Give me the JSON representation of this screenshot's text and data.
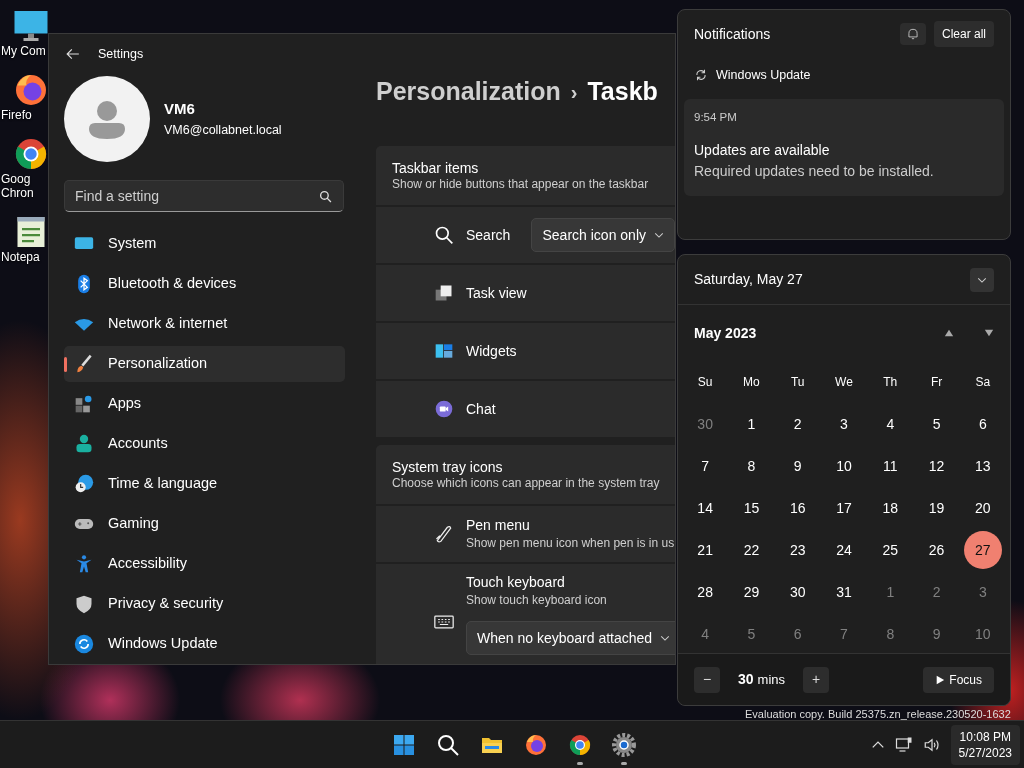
{
  "desktop_icons": [
    {
      "kind": "computer",
      "lines": [
        "My Com"
      ]
    },
    {
      "kind": "firefox",
      "lines": [
        "Firefo"
      ]
    },
    {
      "kind": "chrome",
      "lines": [
        "Goog",
        "Chron"
      ]
    },
    {
      "kind": "notepad",
      "lines": [
        "Notepa"
      ]
    }
  ],
  "settings": {
    "title": "Settings",
    "user": {
      "name": "VM6",
      "email": "VM6@collabnet.local"
    },
    "search": {
      "placeholder": "Find a setting"
    },
    "nav": [
      {
        "kind": "system",
        "label": "System",
        "selected": false
      },
      {
        "kind": "bluetooth",
        "label": "Bluetooth & devices",
        "selected": false
      },
      {
        "kind": "network",
        "label": "Network & internet",
        "selected": false
      },
      {
        "kind": "brush",
        "label": "Personalization",
        "selected": true
      },
      {
        "kind": "apps",
        "label": "Apps",
        "selected": false
      },
      {
        "kind": "accounts",
        "label": "Accounts",
        "selected": false
      },
      {
        "kind": "time",
        "label": "Time & language",
        "selected": false
      },
      {
        "kind": "gaming",
        "label": "Gaming",
        "selected": false
      },
      {
        "kind": "accessibility",
        "label": "Accessibility",
        "selected": false
      },
      {
        "kind": "privacy",
        "label": "Privacy & security",
        "selected": false
      },
      {
        "kind": "update",
        "label": "Windows Update",
        "selected": false
      }
    ],
    "breadcrumb": {
      "parent": "Personalization",
      "separator": "›",
      "current": "Taskb"
    },
    "sections": [
      {
        "title": "Taskbar items",
        "subtitle": "Show or hide buttons that appear on the taskbar",
        "rows": [
          {
            "kind": "search",
            "label": "Search",
            "dropdown": "Search icon only"
          },
          {
            "kind": "taskview",
            "label": "Task view"
          },
          {
            "kind": "widgets",
            "label": "Widgets"
          },
          {
            "kind": "chat",
            "label": "Chat"
          }
        ]
      },
      {
        "title": "System tray icons",
        "subtitle": "Choose which icons can appear in the system tray",
        "rows": [
          {
            "kind": "pen",
            "label": "Pen menu",
            "subtitle": "Show pen menu icon when pen is in us"
          },
          {
            "kind": "keyboard",
            "label": "Touch keyboard",
            "subtitle": "Show touch keyboard icon",
            "dropdown": "When no keyboard attached"
          }
        ]
      }
    ]
  },
  "notifications": {
    "title": "Notifications",
    "clear_button": "Clear all",
    "app": "Windows Update",
    "time": "9:54 PM",
    "headline": "Updates are available",
    "body": "Required updates need to be installed."
  },
  "calendar": {
    "date_heading": "Saturday, May 27",
    "month": "May 2023",
    "weekdays": [
      "Su",
      "Mo",
      "Tu",
      "We",
      "Th",
      "Fr",
      "Sa"
    ],
    "weeks": [
      [
        {
          "d": "30",
          "muted": true,
          "selected": false
        },
        {
          "d": "1",
          "muted": false,
          "selected": false
        },
        {
          "d": "2",
          "muted": false,
          "selected": false
        },
        {
          "d": "3",
          "muted": false,
          "selected": false
        },
        {
          "d": "4",
          "muted": false,
          "selected": false
        },
        {
          "d": "5",
          "muted": false,
          "selected": false
        },
        {
          "d": "6",
          "muted": false,
          "selected": false
        }
      ],
      [
        {
          "d": "7",
          "muted": false,
          "selected": false
        },
        {
          "d": "8",
          "muted": false,
          "selected": false
        },
        {
          "d": "9",
          "muted": false,
          "selected": false
        },
        {
          "d": "10",
          "muted": false,
          "selected": false
        },
        {
          "d": "11",
          "muted": false,
          "selected": false
        },
        {
          "d": "12",
          "muted": false,
          "selected": false
        },
        {
          "d": "13",
          "muted": false,
          "selected": false
        }
      ],
      [
        {
          "d": "14",
          "muted": false,
          "selected": false
        },
        {
          "d": "15",
          "muted": false,
          "selected": false
        },
        {
          "d": "16",
          "muted": false,
          "selected": false
        },
        {
          "d": "17",
          "muted": false,
          "selected": false
        },
        {
          "d": "18",
          "muted": false,
          "selected": false
        },
        {
          "d": "19",
          "muted": false,
          "selected": false
        },
        {
          "d": "20",
          "muted": false,
          "selected": false
        }
      ],
      [
        {
          "d": "21",
          "muted": false,
          "selected": false
        },
        {
          "d": "22",
          "muted": false,
          "selected": false
        },
        {
          "d": "23",
          "muted": false,
          "selected": false
        },
        {
          "d": "24",
          "muted": false,
          "selected": false
        },
        {
          "d": "25",
          "muted": false,
          "selected": false
        },
        {
          "d": "26",
          "muted": false,
          "selected": false
        },
        {
          "d": "27",
          "muted": false,
          "selected": true
        }
      ],
      [
        {
          "d": "28",
          "muted": false,
          "selected": false
        },
        {
          "d": "29",
          "muted": false,
          "selected": false
        },
        {
          "d": "30",
          "muted": false,
          "selected": false
        },
        {
          "d": "31",
          "muted": false,
          "selected": false
        },
        {
          "d": "1",
          "muted": true,
          "selected": false
        },
        {
          "d": "2",
          "muted": true,
          "selected": false
        },
        {
          "d": "3",
          "muted": true,
          "selected": false
        }
      ],
      [
        {
          "d": "4",
          "muted": true,
          "selected": false
        },
        {
          "d": "5",
          "muted": true,
          "selected": false
        },
        {
          "d": "6",
          "muted": true,
          "selected": false
        },
        {
          "d": "7",
          "muted": true,
          "selected": false
        },
        {
          "d": "8",
          "muted": true,
          "selected": false
        },
        {
          "d": "9",
          "muted": true,
          "selected": false
        },
        {
          "d": "10",
          "muted": true,
          "selected": false
        }
      ]
    ],
    "focus": {
      "minus": "−",
      "minutes": "30",
      "unit": "mins",
      "plus": "+",
      "button": "Focus"
    }
  },
  "build_notice": "Evaluation copy. Build 25375.zn_release.230520-1632",
  "taskbar": {
    "apps": [
      {
        "kind": "start",
        "running": false
      },
      {
        "kind": "search",
        "running": false
      },
      {
        "kind": "explorer",
        "running": false
      },
      {
        "kind": "firefox",
        "running": false
      },
      {
        "kind": "chrome",
        "running": true
      },
      {
        "kind": "settings",
        "running": true
      }
    ],
    "time": "10:08 PM",
    "date": "5/27/2023"
  }
}
